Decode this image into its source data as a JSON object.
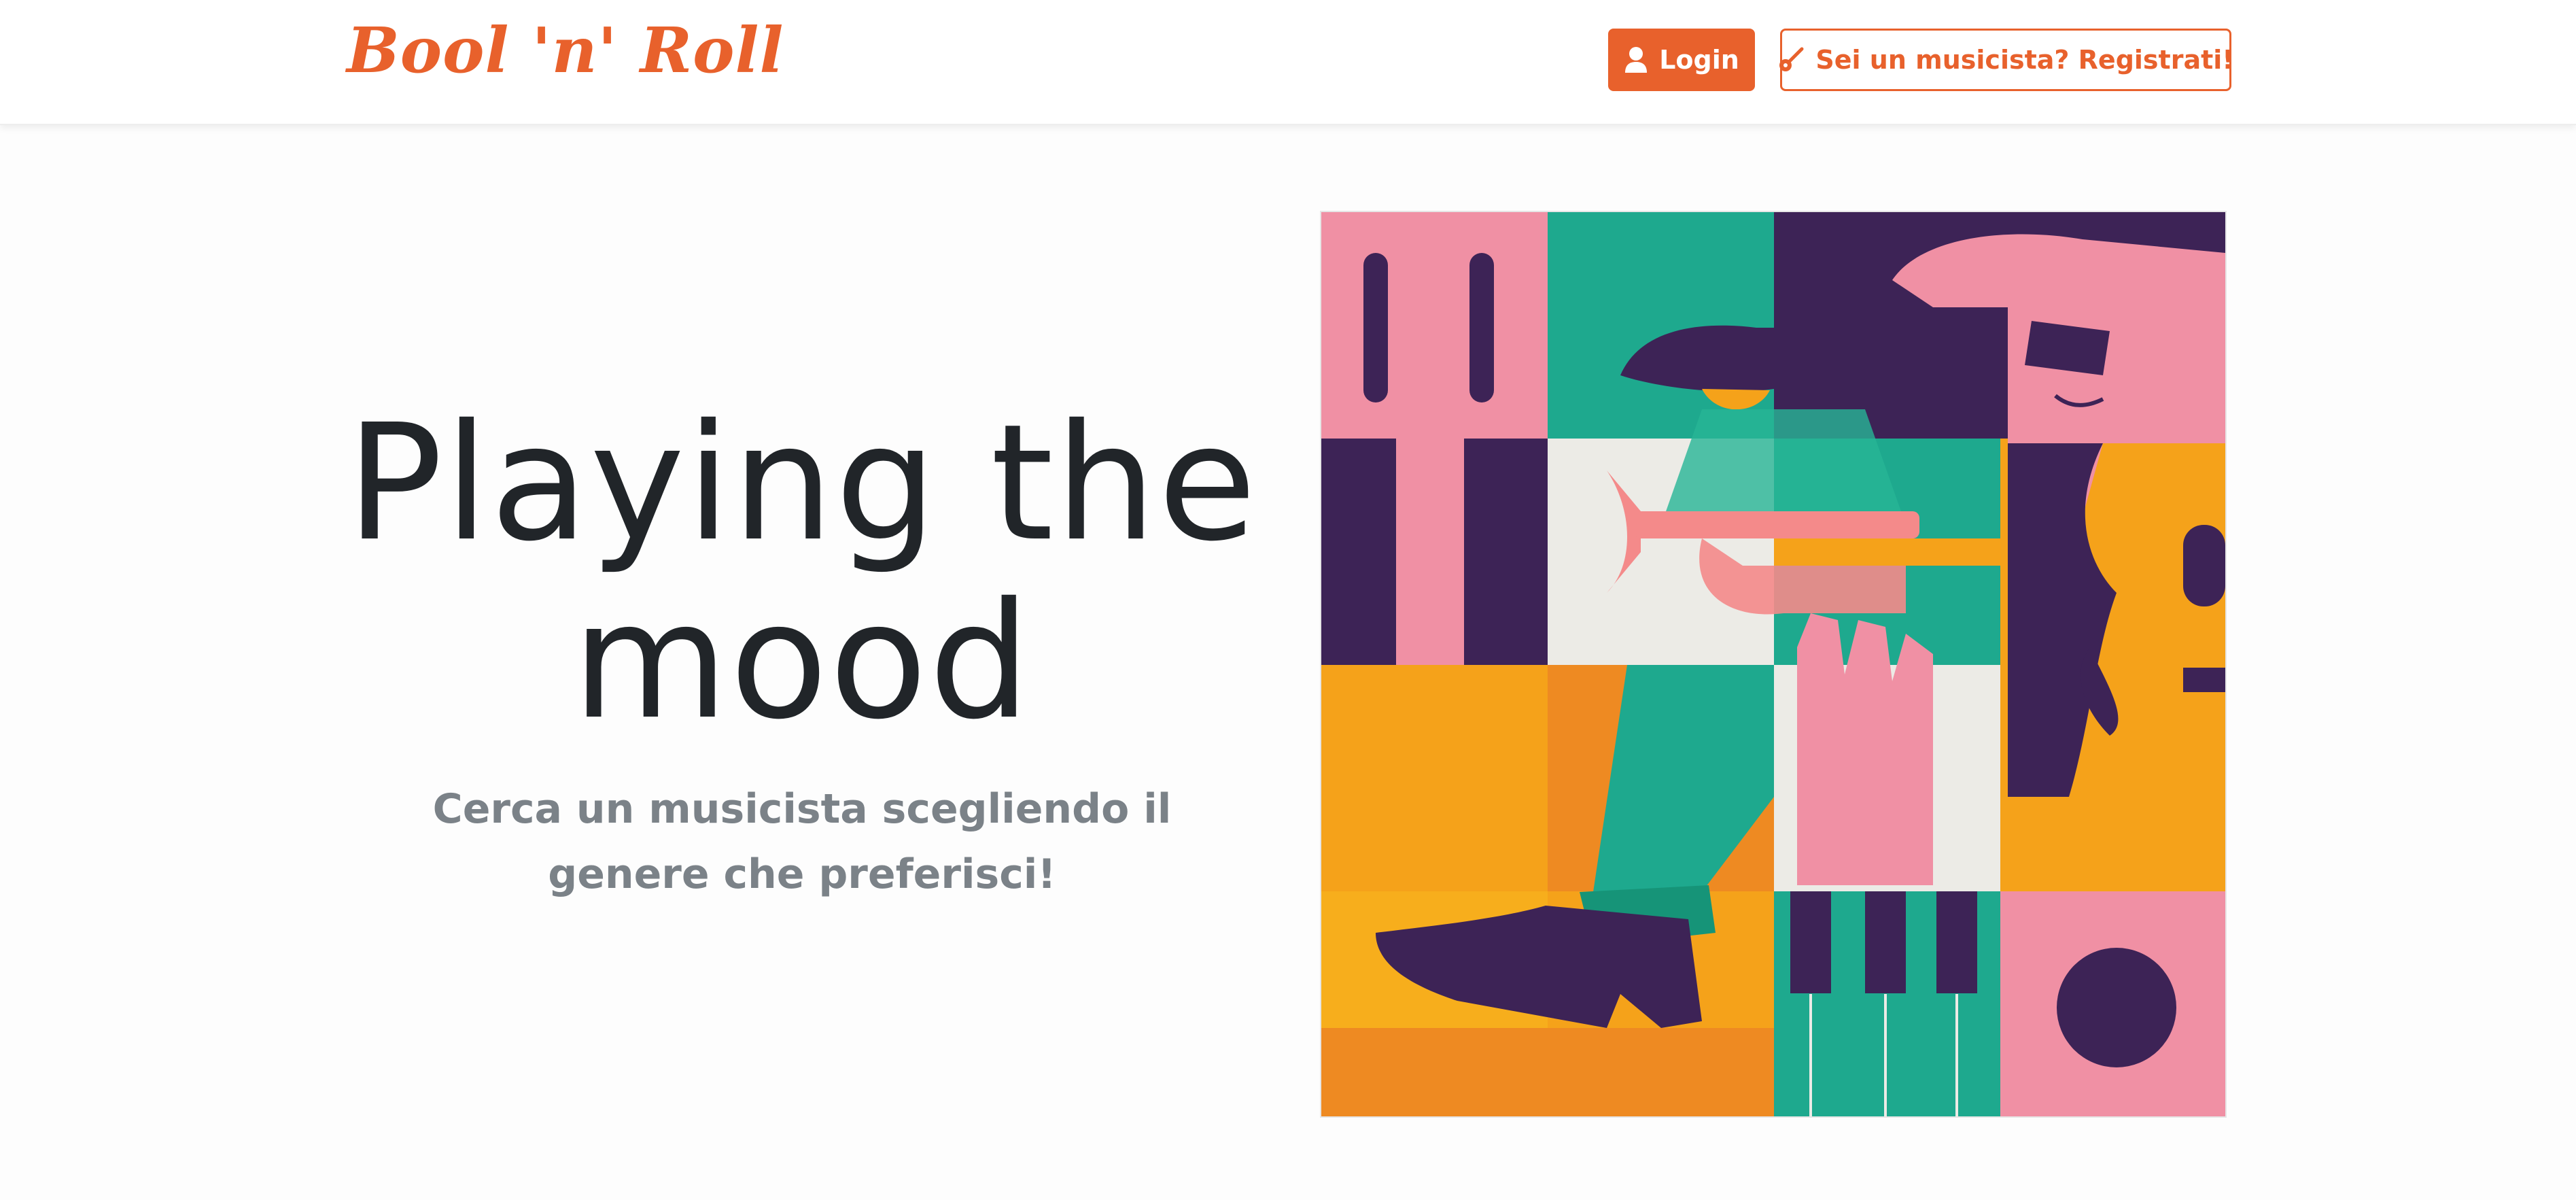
{
  "navbar": {
    "brand": "Bool 'n' Roll",
    "login_label": "Login",
    "register_label": "Sei un musicista? Registrati!"
  },
  "hero": {
    "title": "Playing the mood",
    "subtitle": "Cerca un musicista scegliendo il genere che preferisci!"
  },
  "icons": {
    "login": "user-icon",
    "register": "guitar-icon"
  },
  "colors": {
    "brand": "#e8612c",
    "heading": "#212529",
    "muted": "#7b8288",
    "art_pink": "#f090a4",
    "art_purple": "#3d2356",
    "art_teal": "#1ea98e",
    "art_orange": "#f5a21a",
    "art_cream": "#ecebe6"
  }
}
